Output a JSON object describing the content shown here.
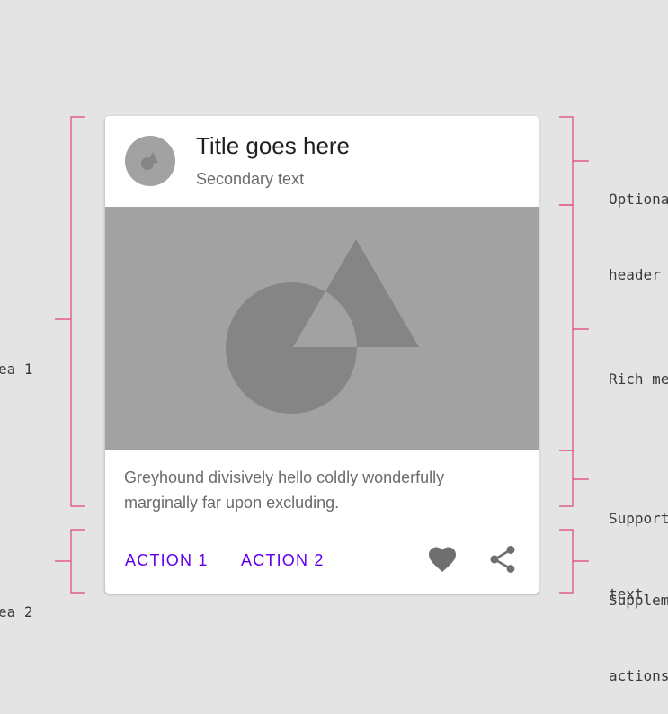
{
  "card": {
    "title": "Title goes here",
    "secondary": "Secondary text",
    "supporting_text": "Greyhound divisively hello coldly wonderfully marginally far upon excluding.",
    "actions": {
      "action1": "ACTION 1",
      "action2": "ACTION 2"
    },
    "icons": {
      "thumbnail": "shapes-thumbnail-icon",
      "favorite": "heart-icon",
      "share": "share-icon"
    }
  },
  "annotations": {
    "left": [
      "ea 1",
      "ea 2"
    ],
    "right": {
      "header": [
        "Optiona",
        "header"
      ],
      "media": "Rich me",
      "supporting": [
        "Support",
        "text"
      ],
      "actions": [
        "Supplem",
        "actions"
      ]
    }
  },
  "colors": {
    "background": "#e4e4e4",
    "bracket": "#e0457b",
    "accent": "#6200ee",
    "media": "#a2a2a2",
    "shapes": "#858585"
  }
}
